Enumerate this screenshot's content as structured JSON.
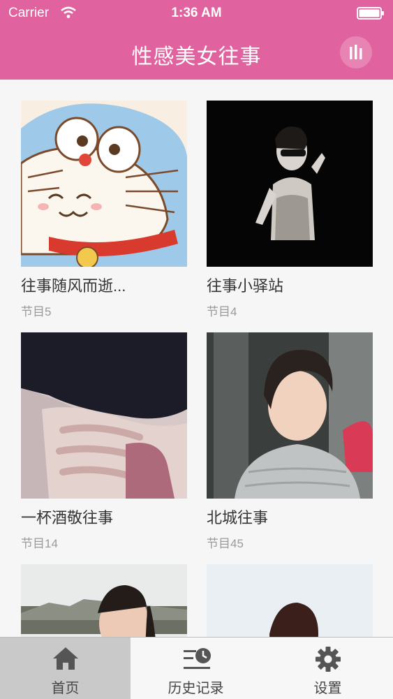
{
  "status_bar": {
    "carrier": "Carrier",
    "time": "1:36 AM"
  },
  "nav": {
    "title": "性感美女往事"
  },
  "albums": [
    {
      "title": "往事随风而逝...",
      "count": "节目5"
    },
    {
      "title": "往事小驿站",
      "count": "节目4"
    },
    {
      "title": "一杯酒敬往事",
      "count": "节目14"
    },
    {
      "title": "北城往事",
      "count": "节目45"
    }
  ],
  "tabs": [
    {
      "label": "首页",
      "icon": "home-icon",
      "selected": true
    },
    {
      "label": "历史记录",
      "icon": "history-icon",
      "selected": false
    },
    {
      "label": "设置",
      "icon": "gear-icon",
      "selected": false
    }
  ],
  "colors": {
    "accent": "#e0629e",
    "tab_selected_bg": "#c9c9c9"
  }
}
